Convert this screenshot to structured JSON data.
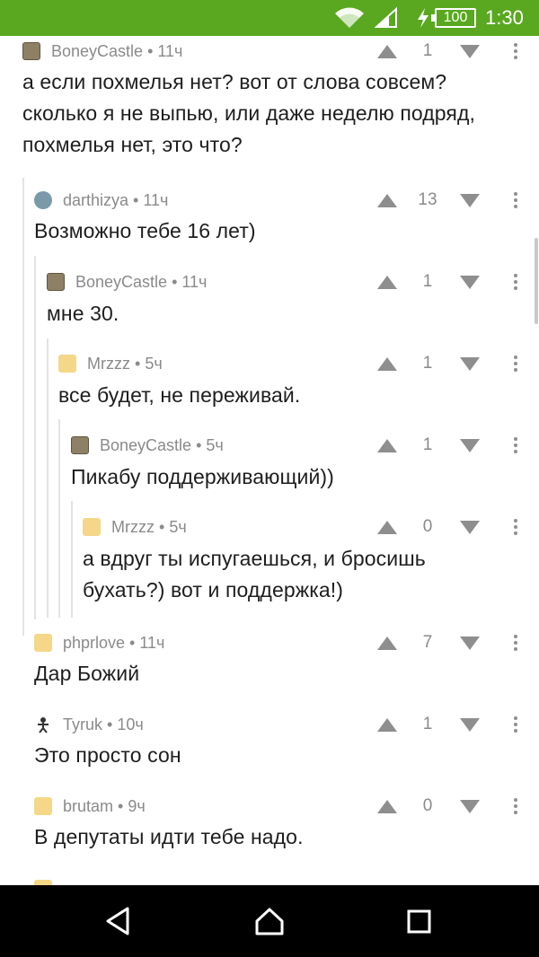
{
  "status_bar": {
    "battery": "100",
    "time": "1:30",
    "icons": [
      "wifi-icon",
      "signal-icon",
      "charging-icon",
      "battery-icon"
    ]
  },
  "comments": [
    {
      "author": "BoneyCastle",
      "time": "11ч",
      "score": "1",
      "text_lines": [
        "а если похмелья нет? вот от слова совсем?",
        "сколько я не выпью, или даже неделю подряд,",
        "похмелья нет, это что?"
      ]
    },
    {
      "author": "darthizya",
      "time": "11ч",
      "score": "13",
      "text_lines": [
        "Возможно тебе 16 лет)"
      ]
    },
    {
      "author": "BoneyCastle",
      "time": "11ч",
      "score": "1",
      "text_lines": [
        "мне 30."
      ]
    },
    {
      "author": "Mrzzz",
      "time": "5ч",
      "score": "1",
      "text_lines": [
        "все будет, не переживай."
      ]
    },
    {
      "author": "BoneyCastle",
      "time": "5ч",
      "score": "1",
      "text_lines": [
        "Пикабу поддерживающий))"
      ]
    },
    {
      "author": "Mrzzz",
      "time": "5ч",
      "score": "0",
      "text_lines": [
        "а вдруг ты испугаешься, и бросишь",
        "бухать?) вот и поддержка!)"
      ]
    },
    {
      "author": "phprlove",
      "time": "11ч",
      "score": "7",
      "text_lines": [
        "Дар Божий"
      ]
    },
    {
      "author": "Tyruk",
      "time": "10ч",
      "score": "1",
      "text_lines": [
        "Это просто сон"
      ]
    },
    {
      "author": "brutam",
      "time": "9ч",
      "score": "0",
      "text_lines": [
        "В депутаты идти тебе надо."
      ]
    }
  ],
  "separator": " • ",
  "nav": {
    "icons": [
      "back-icon",
      "home-icon",
      "recents-icon"
    ]
  },
  "colors": {
    "status_bar": "#59a820",
    "meta_text": "#8a8a8a",
    "body_text": "#1e1e1e",
    "thread_line": "#e3e3e3"
  }
}
